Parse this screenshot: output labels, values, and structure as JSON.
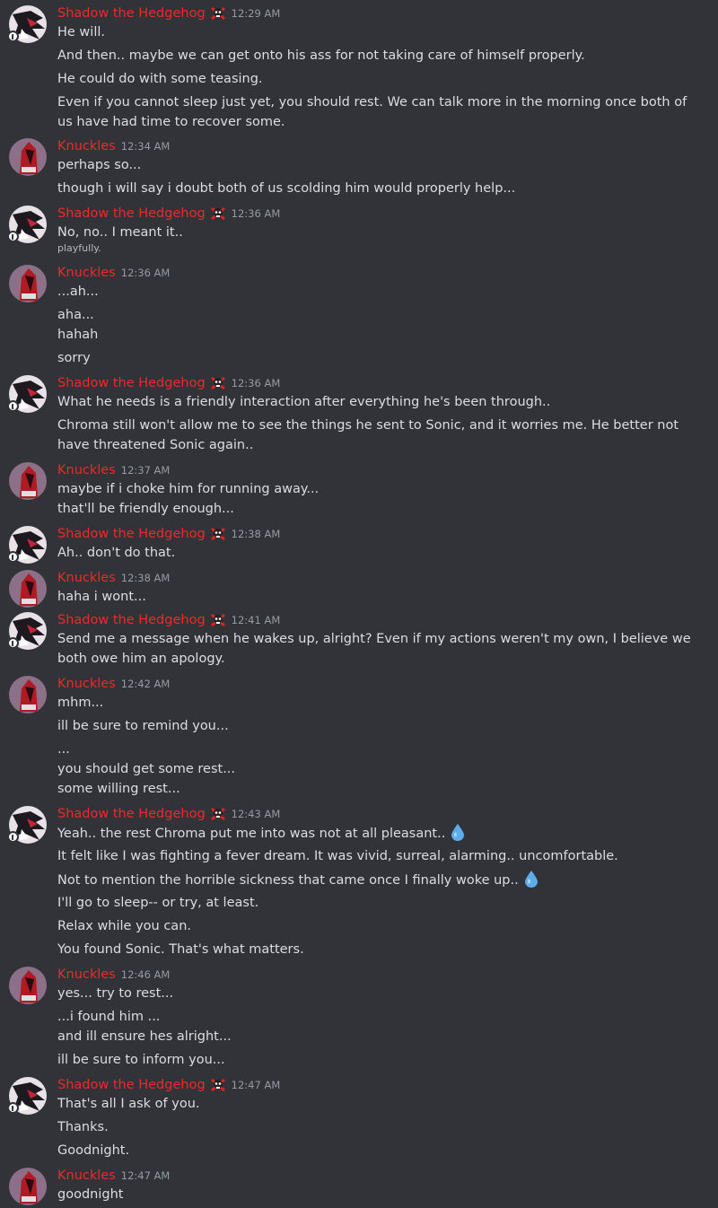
{
  "users": {
    "shadow": {
      "name": "Shadow the Hedgehog"
    },
    "knuckles": {
      "name": "Knuckles"
    }
  },
  "messages": [
    {
      "user": "Shadow the Hedgehog",
      "time": "12:29 AM",
      "lines": [
        "He will.",
        "And then.. maybe we can get onto his ass for not taking care of himself properly.",
        "He could do with some teasing.",
        "Even if you cannot sleep just yet, you should rest. We can talk more in the morning once both of us have had time to recover some."
      ]
    },
    {
      "user": "Knuckles",
      "time": "12:34 AM",
      "lines": [
        "perhaps so...",
        "though i will say i doubt both of us scolding him would properly help..."
      ]
    },
    {
      "user": "Shadow the Hedgehog",
      "time": "12:36 AM",
      "lines": [
        "No, no.. I meant it..",
        "playfully."
      ]
    },
    {
      "user": "Knuckles",
      "time": "12:36 AM",
      "lines": [
        "...ah...",
        "aha...",
        "hahah",
        "sorry"
      ]
    },
    {
      "user": "Shadow the Hedgehog",
      "time": "12:36 AM",
      "lines": [
        "What he needs is a friendly interaction after everything he's been through..",
        "Chroma still won't allow me to see the things he sent to Sonic, and it worries me. He better not have threatened Sonic again.."
      ]
    },
    {
      "user": "Knuckles",
      "time": "12:37 AM",
      "lines": [
        "maybe if i choke him for running away...",
        "that'll be friendly enough..."
      ]
    },
    {
      "user": "Shadow the Hedgehog",
      "time": "12:38 AM",
      "lines": [
        "Ah.. don't do that."
      ]
    },
    {
      "user": "Knuckles",
      "time": "12:38 AM",
      "lines": [
        "haha i wont..."
      ]
    },
    {
      "user": "Shadow the Hedgehog",
      "time": "12:41 AM",
      "lines": [
        "Send me a message when he wakes up, alright? Even if my actions weren't my own, I believe we both owe him an apology."
      ]
    },
    {
      "user": "Knuckles",
      "time": "12:42 AM",
      "lines": [
        "mhm...",
        "ill be sure to remind you...",
        "...",
        "you should get some rest...",
        "some willing rest..."
      ]
    },
    {
      "user": "Shadow the Hedgehog",
      "time": "12:43 AM",
      "lines": [
        "Yeah.. the rest Chroma put me into was not at all pleasant..",
        "It felt like I was fighting a fever dream. It was vivid, surreal, alarming.. uncomfortable.",
        "Not to mention the horrible sickness that came once I finally woke up..",
        "I'll go to sleep-- or try, at least.",
        "Relax while you can.",
        "You found Sonic. That's what matters."
      ]
    },
    {
      "user": "Knuckles",
      "time": "12:46 AM",
      "lines": [
        "yes... try to rest...",
        "...i found him ...",
        "and ill ensure hes alright...",
        "ill be sure to inform you..."
      ]
    },
    {
      "user": "Shadow the Hedgehog",
      "time": "12:47 AM",
      "lines": [
        "That's all I ask of you.",
        "Thanks.",
        "Goodnight."
      ]
    },
    {
      "user": "Knuckles",
      "time": "12:47 AM",
      "lines": [
        "goodnight"
      ]
    }
  ],
  "colors": {
    "background": "#313338",
    "username": "#ec2a2a",
    "text": "#dbdee1",
    "timestamp": "#949ba4",
    "droplet": "#5dadec"
  },
  "icons": {
    "badge": "skull-crossbones-badge-icon",
    "droplet": "sweat-droplet-emoji-icon",
    "status": "mobile-status-icon"
  }
}
